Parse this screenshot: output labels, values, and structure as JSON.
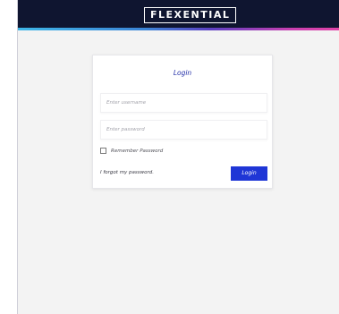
{
  "header": {
    "logo_text": "FLEXENTIAL"
  },
  "login": {
    "title": "Login",
    "username_placeholder": "Enter username",
    "password_placeholder": "Enter password",
    "remember_label": "Remember Password",
    "forgot_label": "I forgot my password.",
    "submit_label": "Login"
  },
  "colors": {
    "topbar": "#0f1530",
    "accent_gradient_start": "#3fb7e8",
    "accent_gradient_end": "#e044a8",
    "primary_button": "#1f36d6",
    "title_text": "#2430a8",
    "page_background": "#f3f3f3"
  }
}
